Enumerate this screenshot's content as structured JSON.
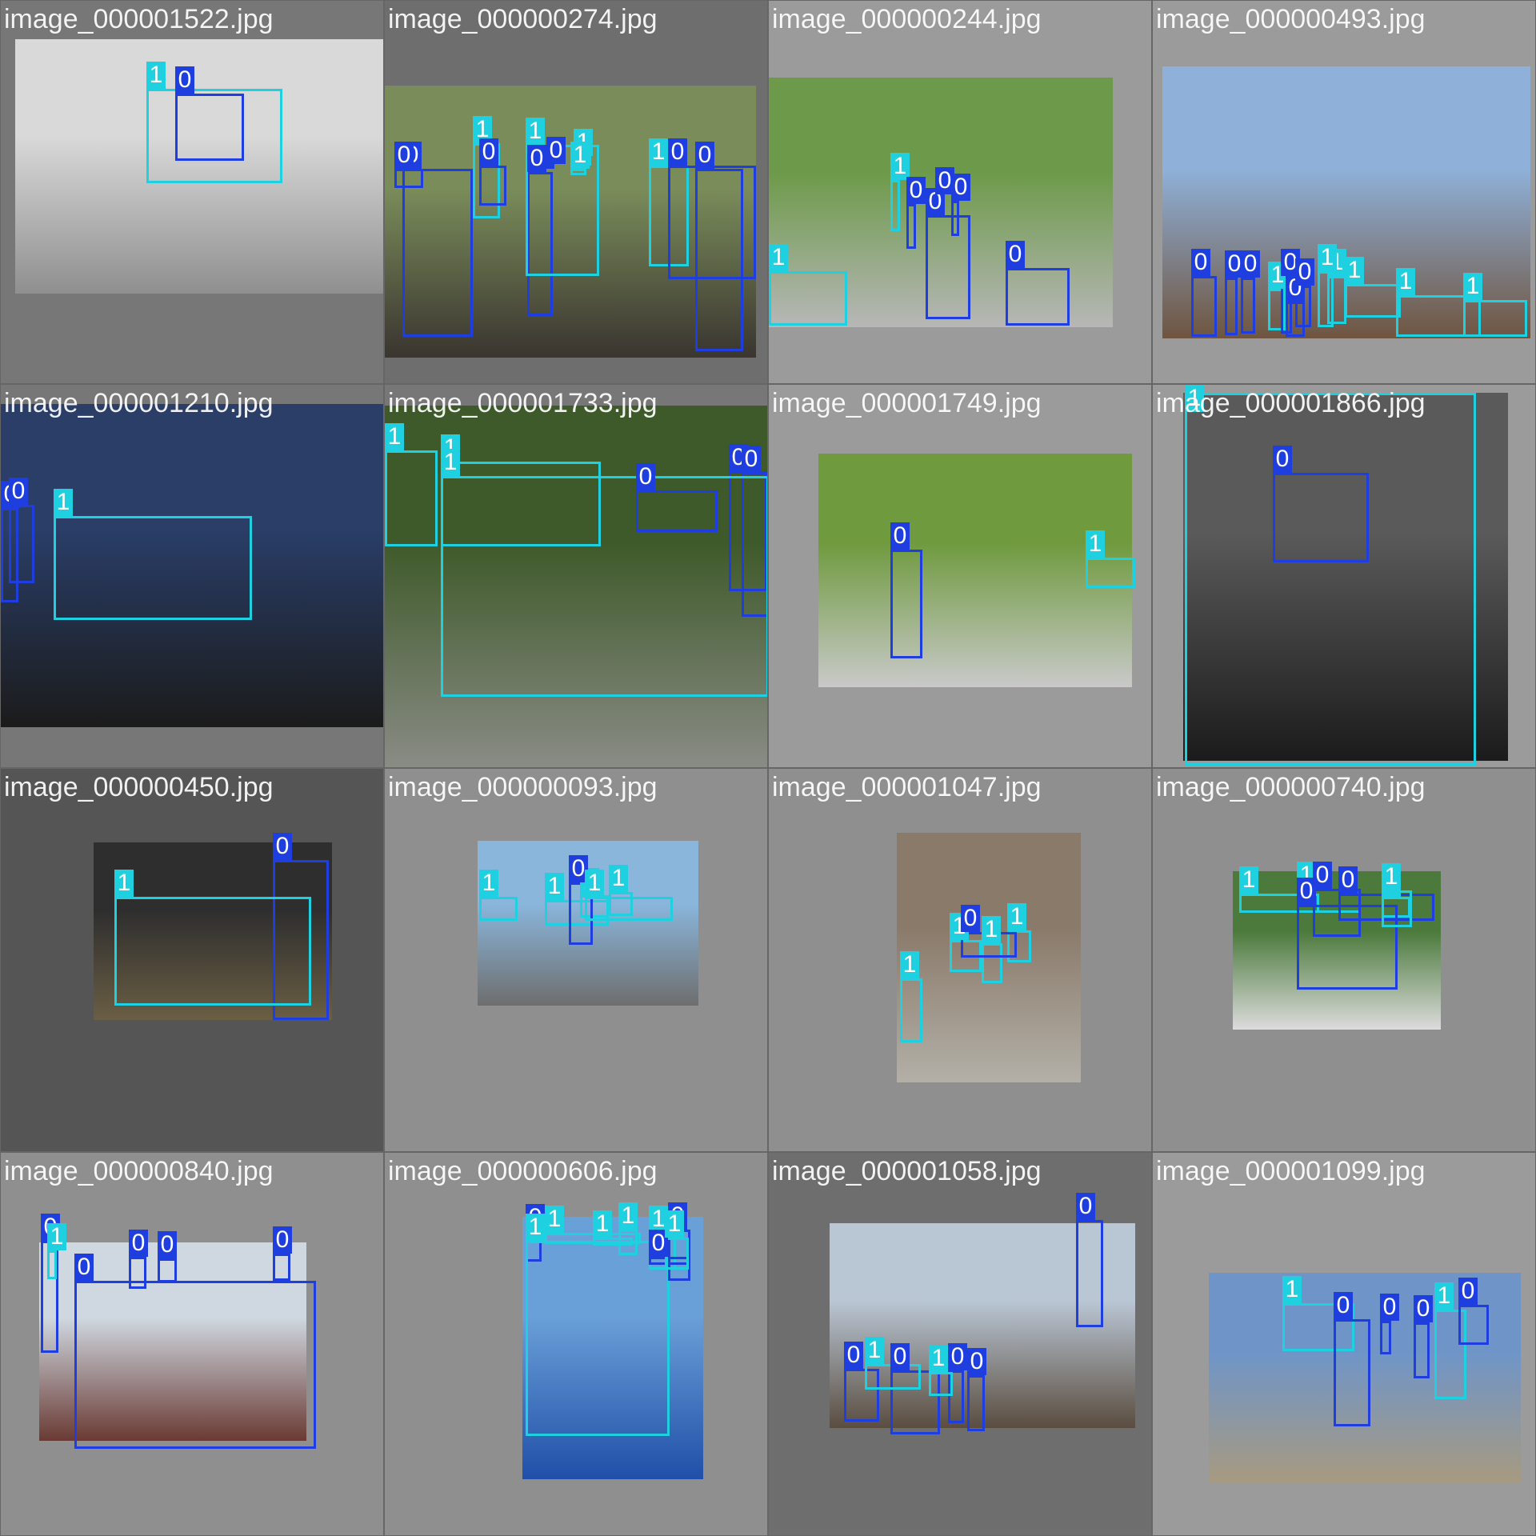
{
  "colors": {
    "class_0": "#1f3ee0",
    "class_1": "#1fd0e0",
    "label_text": "#ffffff"
  },
  "tiles": [
    {
      "title": "image_000001522.jpg",
      "bg": "#777777",
      "photo_colors": [
        "#d9d9d9",
        "#8f8f8f"
      ],
      "boxes": [
        {
          "cls": "1"
        },
        {
          "cls": "0"
        }
      ]
    },
    {
      "title": "image_000000274.jpg",
      "bg": "#6e6e6e",
      "photo_colors": [
        "#7a8c5a",
        "#3a3530"
      ],
      "boxes": [
        {
          "cls": "0"
        },
        {
          "cls": "0"
        },
        {
          "cls": "1"
        },
        {
          "cls": "0"
        },
        {
          "cls": "0"
        },
        {
          "cls": "1"
        },
        {
          "cls": "1"
        },
        {
          "cls": "0"
        },
        {
          "cls": "1"
        },
        {
          "cls": "1"
        },
        {
          "cls": "0"
        },
        {
          "cls": "0"
        }
      ]
    },
    {
      "title": "image_000000244.jpg",
      "bg": "#9b9b9b",
      "photo_colors": [
        "#6d9a4a",
        "#b7b7b7"
      ],
      "boxes": [
        {
          "cls": "1"
        },
        {
          "cls": "1"
        },
        {
          "cls": "0"
        },
        {
          "cls": "0"
        },
        {
          "cls": "0"
        },
        {
          "cls": "0"
        },
        {
          "cls": "0"
        }
      ]
    },
    {
      "title": "image_000000493.jpg",
      "bg": "#9b9b9b",
      "photo_colors": [
        "#8fb0d8",
        "#6f5540"
      ],
      "boxes": [
        {
          "cls": "0"
        },
        {
          "cls": "0"
        },
        {
          "cls": "0"
        },
        {
          "cls": "1"
        },
        {
          "cls": "0"
        },
        {
          "cls": "0"
        },
        {
          "cls": "0"
        },
        {
          "cls": "1"
        },
        {
          "cls": "1"
        },
        {
          "cls": "1"
        },
        {
          "cls": "1"
        },
        {
          "cls": "1"
        }
      ]
    },
    {
      "title": "image_000001210.jpg",
      "bg": "#777777",
      "photo_colors": [
        "#2a3e68",
        "#1b1b1b"
      ],
      "boxes": [
        {
          "cls": "0"
        },
        {
          "cls": "0"
        },
        {
          "cls": "1"
        }
      ]
    },
    {
      "title": "image_000001733.jpg",
      "bg": "#777777",
      "photo_colors": [
        "#3f5a2a",
        "#8a8c86"
      ],
      "boxes": [
        {
          "cls": "1"
        },
        {
          "cls": "1"
        },
        {
          "cls": "0"
        },
        {
          "cls": "0"
        },
        {
          "cls": "0"
        },
        {
          "cls": "1"
        }
      ]
    },
    {
      "title": "image_000001749.jpg",
      "bg": "#9b9b9b",
      "photo_colors": [
        "#6f9a3e",
        "#c9c9c9"
      ],
      "boxes": [
        {
          "cls": "0"
        },
        {
          "cls": "1"
        }
      ]
    },
    {
      "title": "image_000001866.jpg",
      "bg": "#9b9b9b",
      "photo_colors": [
        "#5a5a5a",
        "#1b1b1b"
      ],
      "boxes": [
        {
          "cls": "1"
        },
        {
          "cls": "0"
        }
      ]
    },
    {
      "title": "image_000000450.jpg",
      "bg": "#555555",
      "photo_colors": [
        "#2e2e2e",
        "#6a5e44"
      ],
      "boxes": [
        {
          "cls": "0"
        },
        {
          "cls": "1"
        }
      ]
    },
    {
      "title": "image_000000093.jpg",
      "bg": "#8f8f8f",
      "photo_colors": [
        "#8ab6dc",
        "#6e6e6e"
      ],
      "boxes": [
        {
          "cls": "1"
        },
        {
          "cls": "1"
        },
        {
          "cls": "1"
        },
        {
          "cls": "0"
        },
        {
          "cls": "1"
        },
        {
          "cls": "1"
        }
      ]
    },
    {
      "title": "image_000001047.jpg",
      "bg": "#8f8f8f",
      "photo_colors": [
        "#8a7a6a",
        "#b3b0a8"
      ],
      "boxes": [
        {
          "cls": "1"
        },
        {
          "cls": "1"
        },
        {
          "cls": "1"
        },
        {
          "cls": "1"
        },
        {
          "cls": "0"
        }
      ]
    },
    {
      "title": "image_000000740.jpg",
      "bg": "#8f8f8f",
      "photo_colors": [
        "#4c7a3c",
        "#dcdcdc"
      ],
      "boxes": [
        {
          "cls": "1"
        },
        {
          "cls": "1"
        },
        {
          "cls": "0"
        },
        {
          "cls": "0"
        },
        {
          "cls": "1"
        },
        {
          "cls": "0"
        },
        {
          "cls": "1"
        }
      ]
    },
    {
      "title": "image_000000840.jpg",
      "bg": "#8f8f8f",
      "photo_colors": [
        "#cfd8e0",
        "#6a3a34"
      ],
      "boxes": [
        {
          "cls": "0"
        },
        {
          "cls": "1"
        },
        {
          "cls": "0"
        },
        {
          "cls": "0"
        },
        {
          "cls": "0"
        },
        {
          "cls": "0"
        },
        {
          "cls": "1"
        }
      ]
    },
    {
      "title": "image_000000606.jpg",
      "bg": "#8f8f8f",
      "photo_colors": [
        "#6aa0d8",
        "#1f4fa8"
      ],
      "boxes": [
        {
          "cls": "0"
        },
        {
          "cls": "1"
        },
        {
          "cls": "1"
        },
        {
          "cls": "1"
        },
        {
          "cls": "1"
        },
        {
          "cls": "0"
        },
        {
          "cls": "1"
        },
        {
          "cls": "0"
        },
        {
          "cls": "1"
        }
      ]
    },
    {
      "title": "image_000001058.jpg",
      "bg": "#6e6e6e",
      "photo_colors": [
        "#b9c6d4",
        "#5a4d40"
      ],
      "boxes": [
        {
          "cls": "0"
        },
        {
          "cls": "0"
        },
        {
          "cls": "0"
        },
        {
          "cls": "0"
        },
        {
          "cls": "0"
        },
        {
          "cls": "1"
        },
        {
          "cls": "1"
        },
        {
          "cls": "1"
        },
        {
          "cls": "0"
        },
        {
          "cls": "0"
        },
        {
          "cls": "1"
        }
      ]
    },
    {
      "title": "image_000001099.jpg",
      "bg": "#9b9b9b",
      "photo_colors": [
        "#6f95c8",
        "#a79a80"
      ],
      "boxes": [
        {
          "cls": "1"
        },
        {
          "cls": "0"
        },
        {
          "cls": "0"
        },
        {
          "cls": "0"
        },
        {
          "cls": "1"
        },
        {
          "cls": "0"
        }
      ]
    }
  ]
}
